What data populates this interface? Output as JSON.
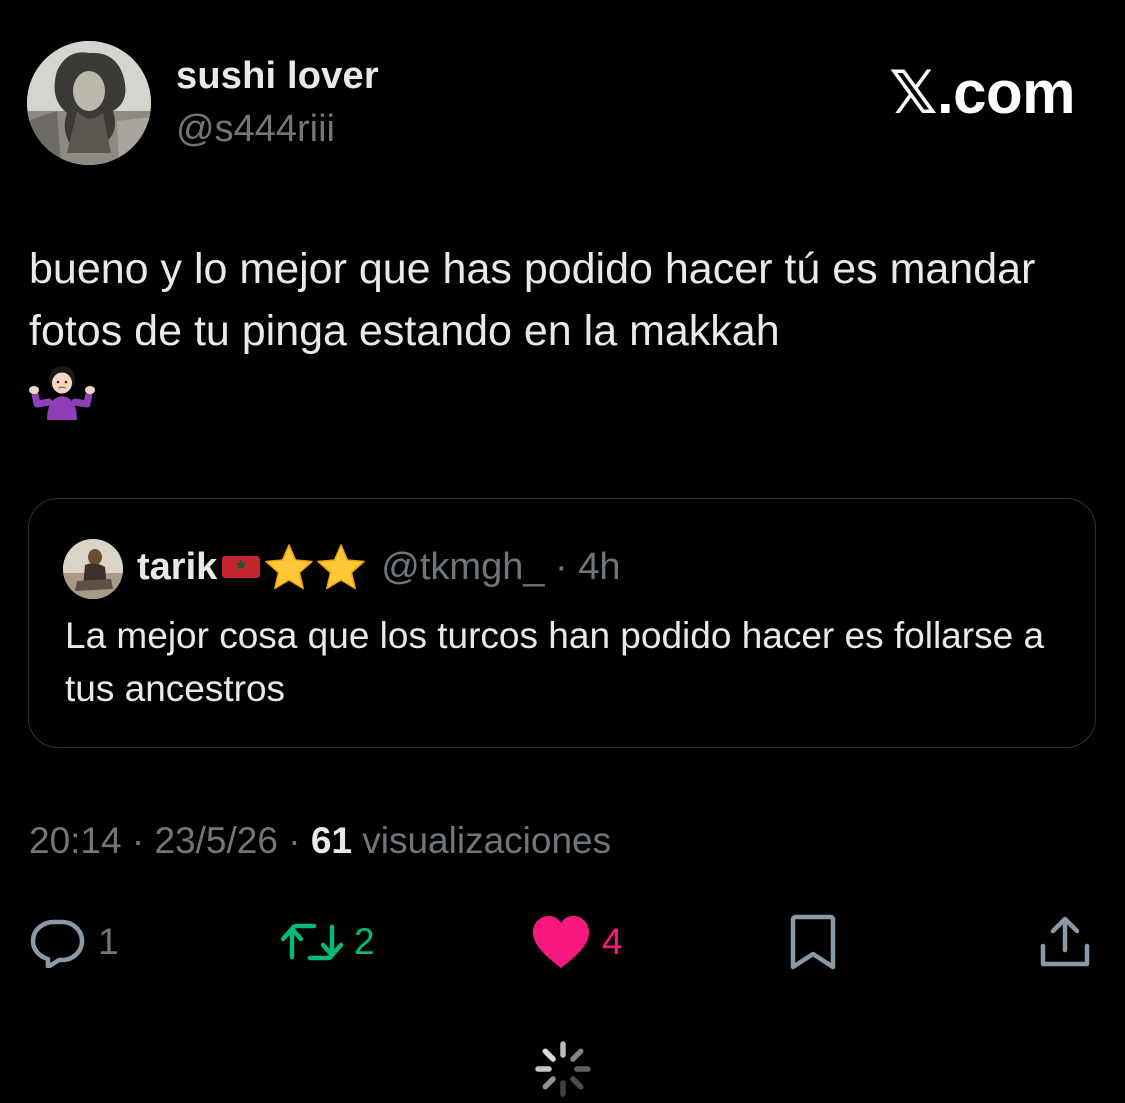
{
  "header": {
    "display_name": "sushi lover",
    "handle": "@s444riii",
    "brand": "𝕏.com"
  },
  "tweet": {
    "text": "bueno y lo mejor que has podido hacer tú es mandar fotos de tu pinga estando en la makkah",
    "emoji": "person-shrugging-emoji"
  },
  "quoted_tweet": {
    "display_name": "tarik",
    "badges": [
      "morocco-flag-icon",
      "star-icon",
      "star-icon"
    ],
    "handle": "@tkmgh_",
    "separator": " · ",
    "time": "4h",
    "text": "La mejor cosa que los turcos han podido hacer es follarse a tus ancestros"
  },
  "meta": {
    "time": "20:14",
    "sep1": " · ",
    "date": "23/5/26",
    "sep2": " · ",
    "views_count": "61",
    "views_label": " visualizaciones"
  },
  "actions": {
    "reply_count": "1",
    "retweet_count": "2",
    "like_count": "4"
  },
  "colors": {
    "background": "#000000",
    "text_primary": "#e7e9ea",
    "text_secondary": "#71767b",
    "border": "#2f3336",
    "retweet_green": "#00ba7c",
    "like_pink": "#f91880"
  }
}
